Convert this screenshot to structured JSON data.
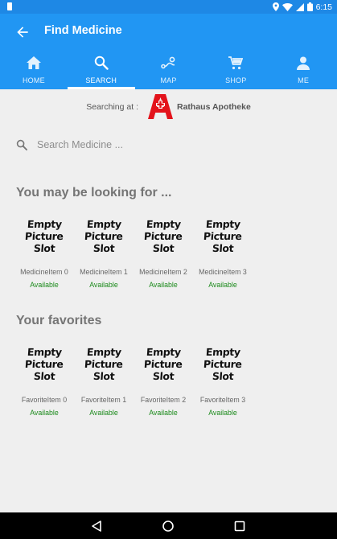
{
  "status_bar": {
    "time": "6:15"
  },
  "app_bar": {
    "title": "Find Medicine"
  },
  "tabs": [
    {
      "label": "HOME",
      "icon": "home-icon"
    },
    {
      "label": "SEARCH",
      "icon": "search-icon"
    },
    {
      "label": "MAP",
      "icon": "map-route-icon"
    },
    {
      "label": "SHOP",
      "icon": "shopping-cart-icon"
    },
    {
      "label": "ME",
      "icon": "person-icon"
    }
  ],
  "active_tab": "SEARCH",
  "pharmacy": {
    "searching_label": "Searching at :",
    "name": "Rathaus Apotheke",
    "logo": "apotheke-logo"
  },
  "search": {
    "placeholder": "Search Medicine ..."
  },
  "suggestions": {
    "title": "You may be looking for ...",
    "items": [
      {
        "image_text": [
          "Empty",
          "Picture",
          "Slot"
        ],
        "name": "MedicineItem 0",
        "status": "Available"
      },
      {
        "image_text": [
          "Empty",
          "Picture",
          "Slot"
        ],
        "name": "MedicineItem 1",
        "status": "Available"
      },
      {
        "image_text": [
          "Empty",
          "Picture",
          "Slot"
        ],
        "name": "MedicineItem 2",
        "status": "Available"
      },
      {
        "image_text": [
          "Empty",
          "Picture",
          "Slot"
        ],
        "name": "MedicineItem 3",
        "status": "Available"
      }
    ]
  },
  "favorites": {
    "title": "Your favorites",
    "items": [
      {
        "image_text": [
          "Empty",
          "Picture",
          "Slot"
        ],
        "name": "FavoriteItem 0",
        "status": "Available"
      },
      {
        "image_text": [
          "Empty",
          "Picture",
          "Slot"
        ],
        "name": "FavoriteItem 1",
        "status": "Available"
      },
      {
        "image_text": [
          "Empty",
          "Picture",
          "Slot"
        ],
        "name": "FavoriteItem 2",
        "status": "Available"
      },
      {
        "image_text": [
          "Empty",
          "Picture",
          "Slot"
        ],
        "name": "FavoriteItem 3",
        "status": "Available"
      }
    ]
  },
  "colors": {
    "primary": "#2196f3",
    "status_bar": "#1e88e5",
    "available": "#1b8a1b",
    "logo_red": "#e3131b",
    "background": "#efefef"
  }
}
